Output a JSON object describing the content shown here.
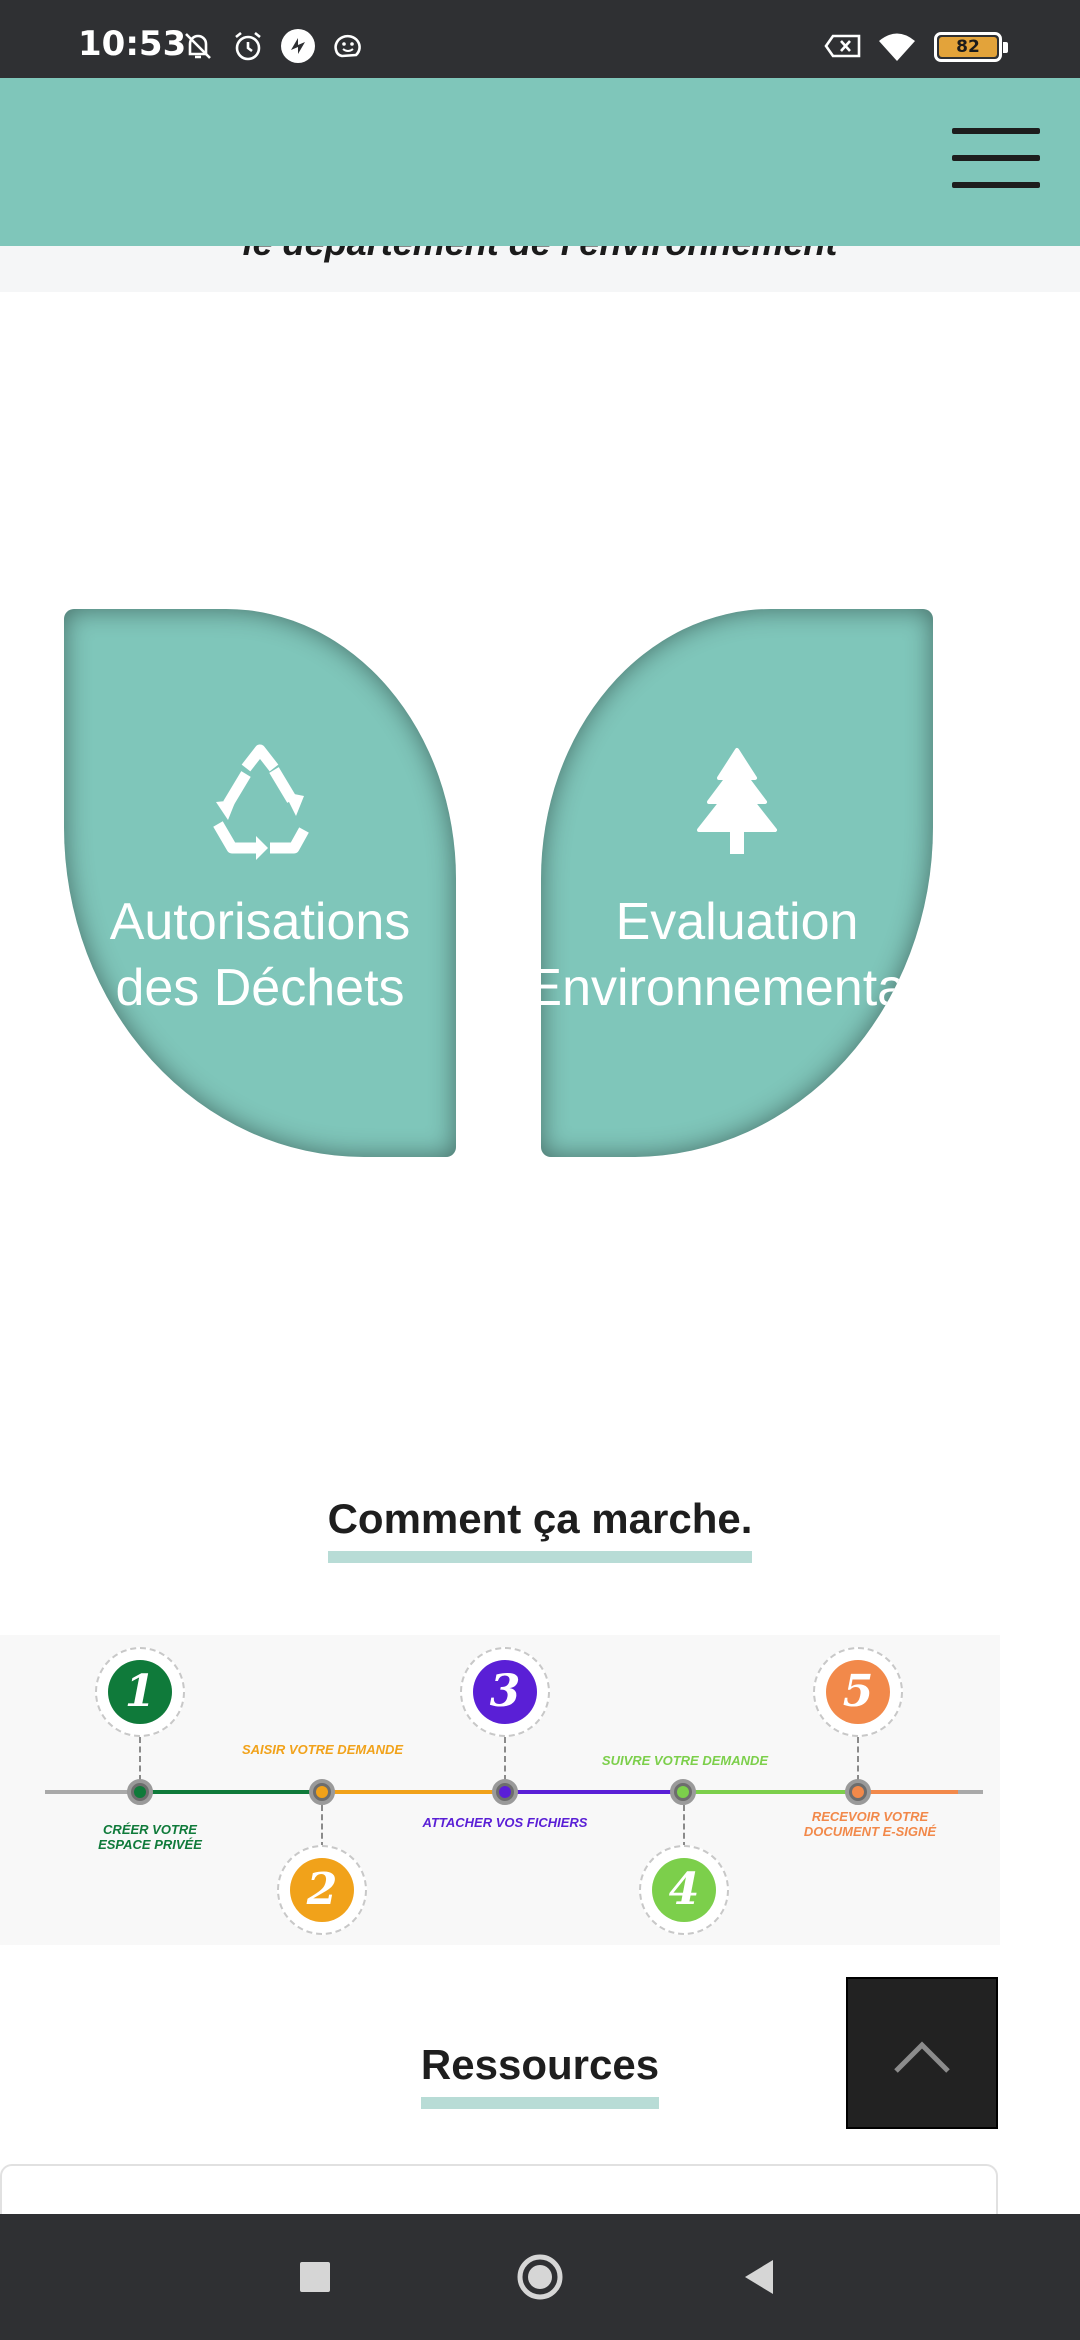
{
  "status_bar": {
    "time": "10:53",
    "battery": "82",
    "icons": [
      "bell-off-icon",
      "alarm-icon",
      "vpn-icon",
      "waze-icon",
      "sim-off-icon",
      "wifi-icon",
      "battery-icon"
    ]
  },
  "header": {
    "menu_icon": "hamburger-menu-icon"
  },
  "subtitle": "le département de l'environnement",
  "cards": [
    {
      "title": "Autorisations\ndes Déchets",
      "icon": "recycle-icon"
    },
    {
      "title": "Evaluation\nEnvironnementale",
      "icon": "tree-icon"
    }
  ],
  "how_it_works": {
    "heading": "Comment ça marche.",
    "steps": [
      {
        "number": "1",
        "label": "Créer votre\nespace privée",
        "color": "#0f7a3a"
      },
      {
        "number": "2",
        "label": "Saisir votre demande",
        "color": "#f1a21a"
      },
      {
        "number": "3",
        "label": "Attacher vos fichiers",
        "color": "#5a1fd6"
      },
      {
        "number": "4",
        "label": "Suivre votre demande",
        "color": "#7ccf4b"
      },
      {
        "number": "5",
        "label": "Recevoir votre\ndocument e-signé",
        "color": "#f2894a"
      }
    ]
  },
  "resources": {
    "heading": "Ressources"
  },
  "back_to_top": {
    "icon": "chevron-up-icon"
  },
  "nav_bar": {
    "icons": [
      "recents-square-icon",
      "home-circle-icon",
      "back-triangle-icon"
    ]
  },
  "colors": {
    "accent": "#7fc6ba",
    "underline": "#b8dcd6",
    "dark": "#2f3033"
  }
}
